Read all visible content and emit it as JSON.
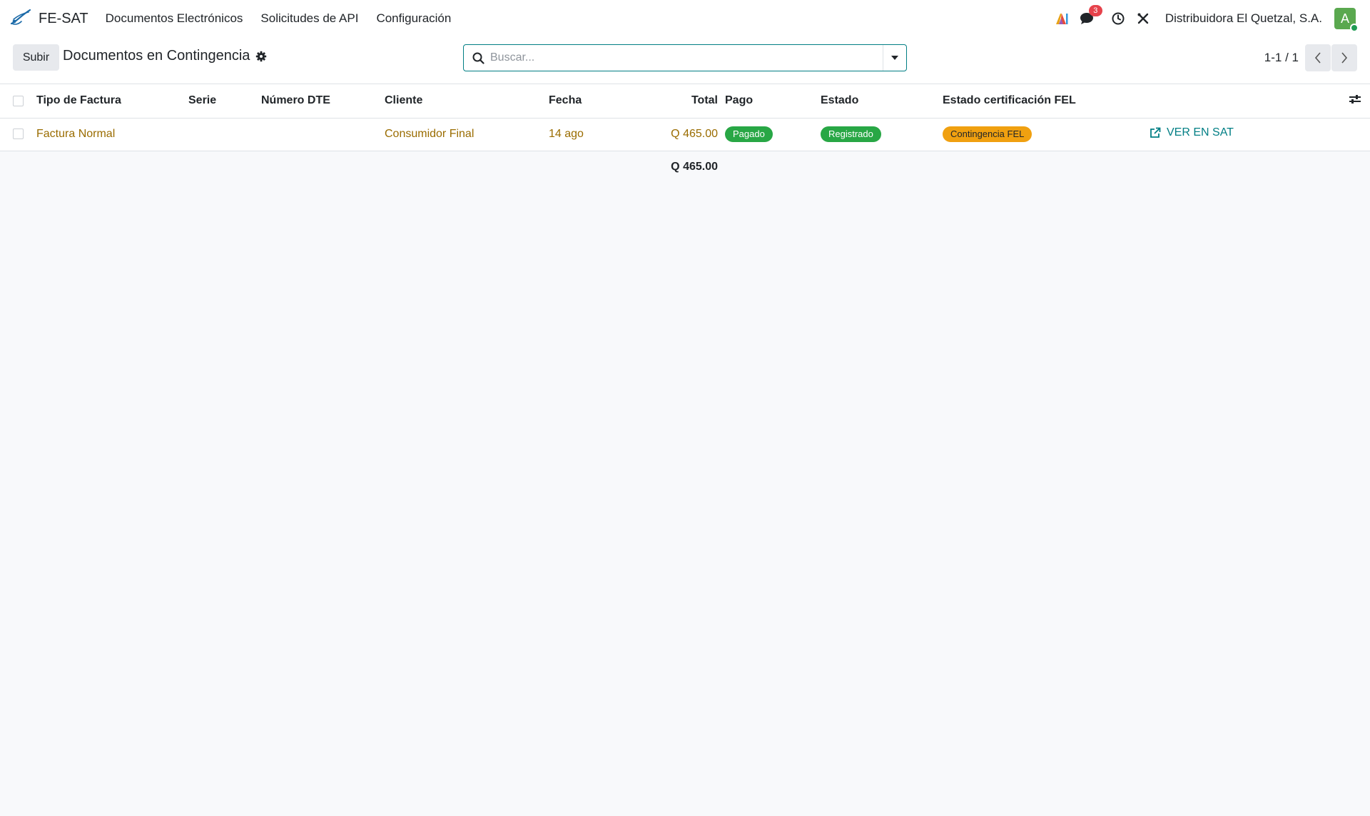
{
  "app": {
    "name": "FE-SAT",
    "menu": [
      {
        "label": "Documentos Electrónicos"
      },
      {
        "label": "Solicitudes de API"
      },
      {
        "label": "Configuración"
      }
    ],
    "chat_count": "3",
    "company": "Distribuidora El Quetzal, S.A.",
    "avatar_letter": "A"
  },
  "control": {
    "upload_label": "Subir",
    "title": "Documentos en Contingencia",
    "search_placeholder": "Buscar...",
    "pager": "1-1 / 1"
  },
  "table": {
    "headers": {
      "tipo": "Tipo de Factura",
      "serie": "Serie",
      "numero": "Número DTE",
      "cliente": "Cliente",
      "fecha": "Fecha",
      "total": "Total",
      "pago": "Pago",
      "estado": "Estado",
      "estado_fel": "Estado certificación FEL"
    },
    "rows": [
      {
        "tipo": "Factura Normal",
        "serie": "",
        "numero": "",
        "cliente": "Consumidor Final",
        "fecha": "14 ago",
        "total": "Q 465.00",
        "pago": "Pagado",
        "estado": "Registrado",
        "estado_fel": "Contingencia FEL",
        "action": "VER EN SAT"
      }
    ],
    "footer_total": "Q 465.00"
  },
  "colors": {
    "accent": "#017e84",
    "link": "#9a6c00",
    "success_badge": "#28a745",
    "warning_badge": "#f0a010",
    "notification": "#e6424b"
  }
}
